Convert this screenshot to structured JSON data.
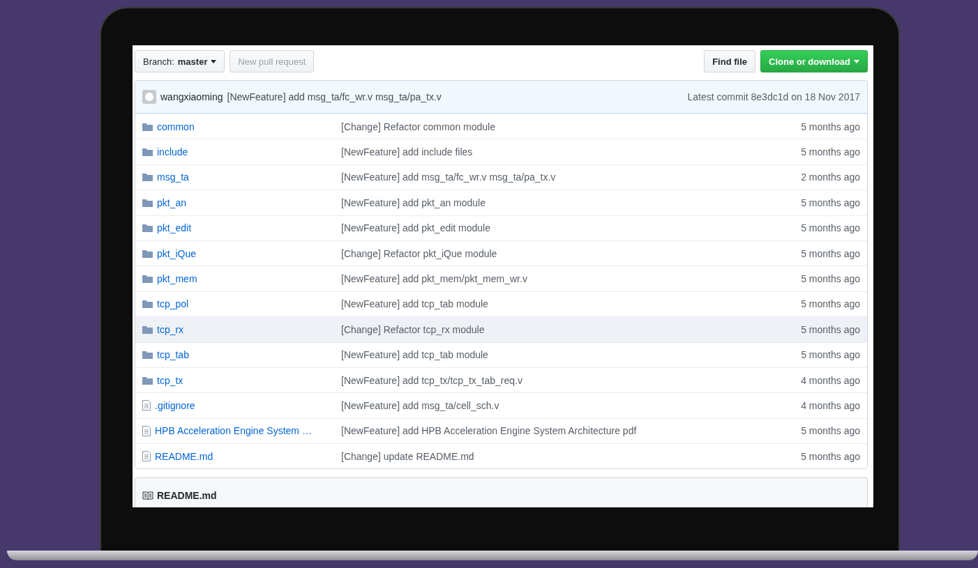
{
  "toolbar": {
    "branch_label": "Branch:",
    "branch": "master",
    "new_pull_request": {
      "label": "New pull request",
      "disabled": true
    },
    "find_file": "Find file",
    "clone": "Clone or download"
  },
  "commit": {
    "author": "wangxiaoming",
    "message": "[NewFeature] add msg_ta/fc_wr.v msg_ta/pa_tx.v",
    "latest": "Latest commit 8e3dc1d on 18 Nov 2017"
  },
  "files": [
    {
      "kind": "folder",
      "name": "common",
      "message": "[Change] Refactor common module",
      "age": "5 months ago",
      "hovered": false
    },
    {
      "kind": "folder",
      "name": "include",
      "message": "[NewFeature] add include files",
      "age": "5 months ago",
      "hovered": false
    },
    {
      "kind": "folder",
      "name": "msg_ta",
      "message": "[NewFeature] add msg_ta/fc_wr.v msg_ta/pa_tx.v",
      "age": "2 months ago",
      "hovered": false
    },
    {
      "kind": "folder",
      "name": "pkt_an",
      "message": "[NewFeature] add pkt_an module",
      "age": "5 months ago",
      "hovered": false
    },
    {
      "kind": "folder",
      "name": "pkt_edit",
      "message": "[NewFeature] add pkt_edit module",
      "age": "5 months ago",
      "hovered": false
    },
    {
      "kind": "folder",
      "name": "pkt_iQue",
      "message": "[Change] Refactor pkt_iQue module",
      "age": "5 months ago",
      "hovered": false
    },
    {
      "kind": "folder",
      "name": "pkt_mem",
      "message": "[NewFeature] add pkt_mem/pkt_mem_wr.v",
      "age": "5 months ago",
      "hovered": false
    },
    {
      "kind": "folder",
      "name": "tcp_pol",
      "message": "[NewFeature] add tcp_tab module",
      "age": "5 months ago",
      "hovered": false
    },
    {
      "kind": "folder",
      "name": "tcp_rx",
      "message": "[Change] Refactor tcp_rx module",
      "age": "5 months ago",
      "hovered": true
    },
    {
      "kind": "folder",
      "name": "tcp_tab",
      "message": "[NewFeature] add tcp_tab module",
      "age": "5 months ago",
      "hovered": false
    },
    {
      "kind": "folder",
      "name": "tcp_tx",
      "message": "[NewFeature] add tcp_tx/tcp_tx_tab_req.v",
      "age": "4 months ago",
      "hovered": false
    },
    {
      "kind": "file",
      "name": ".gitignore",
      "message": "[NewFeature] add msg_ta/cell_sch.v",
      "age": "4 months ago",
      "hovered": false
    },
    {
      "kind": "file",
      "name": "HPB Acceleration Engine System …",
      "message": "[NewFeature] add HPB Acceleration Engine System Architecture pdf",
      "age": "5 months ago",
      "hovered": false
    },
    {
      "kind": "file",
      "name": "README.md",
      "message": "[Change] update README.md",
      "age": "5 months ago",
      "hovered": false
    }
  ],
  "readme": {
    "title": "README.md"
  }
}
